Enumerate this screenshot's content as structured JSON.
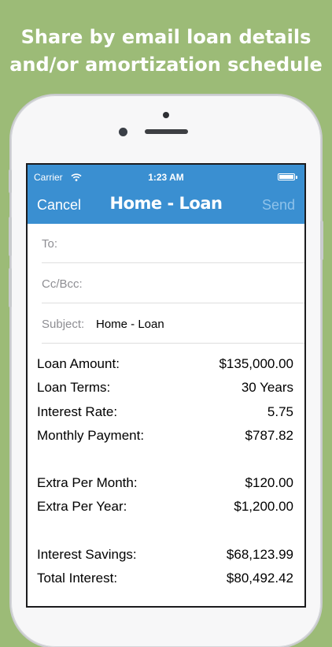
{
  "headline": {
    "line1": "Share by email loan details",
    "line2": "and/or amortization schedule"
  },
  "status_bar": {
    "carrier": "Carrier",
    "time": "1:23 AM"
  },
  "nav": {
    "cancel": "Cancel",
    "title": "Home - Loan",
    "send": "Send"
  },
  "fields": {
    "to_label": "To:",
    "cc_label": "Cc/Bcc:",
    "subject_label": "Subject:",
    "subject_value": "Home - Loan"
  },
  "details": {
    "group1": [
      {
        "label": "Loan Amount:",
        "value": "$135,000.00"
      },
      {
        "label": "Loan Terms:",
        "value": "30 Years"
      },
      {
        "label": "Interest Rate:",
        "value": "5.75"
      },
      {
        "label": "Monthly Payment:",
        "value": "$787.82"
      }
    ],
    "group2": [
      {
        "label": "Extra Per Month:",
        "value": "$120.00"
      },
      {
        "label": "Extra Per Year:",
        "value": "$1,200.00"
      }
    ],
    "group3": [
      {
        "label": "Interest Savings:",
        "value": "$68,123.99"
      },
      {
        "label": "Total Interest:",
        "value": "$80,492.42"
      }
    ]
  },
  "colors": {
    "background": "#9cbb77",
    "nav_bar": "#3a8fd1",
    "send_disabled": "#8ec2ea"
  }
}
